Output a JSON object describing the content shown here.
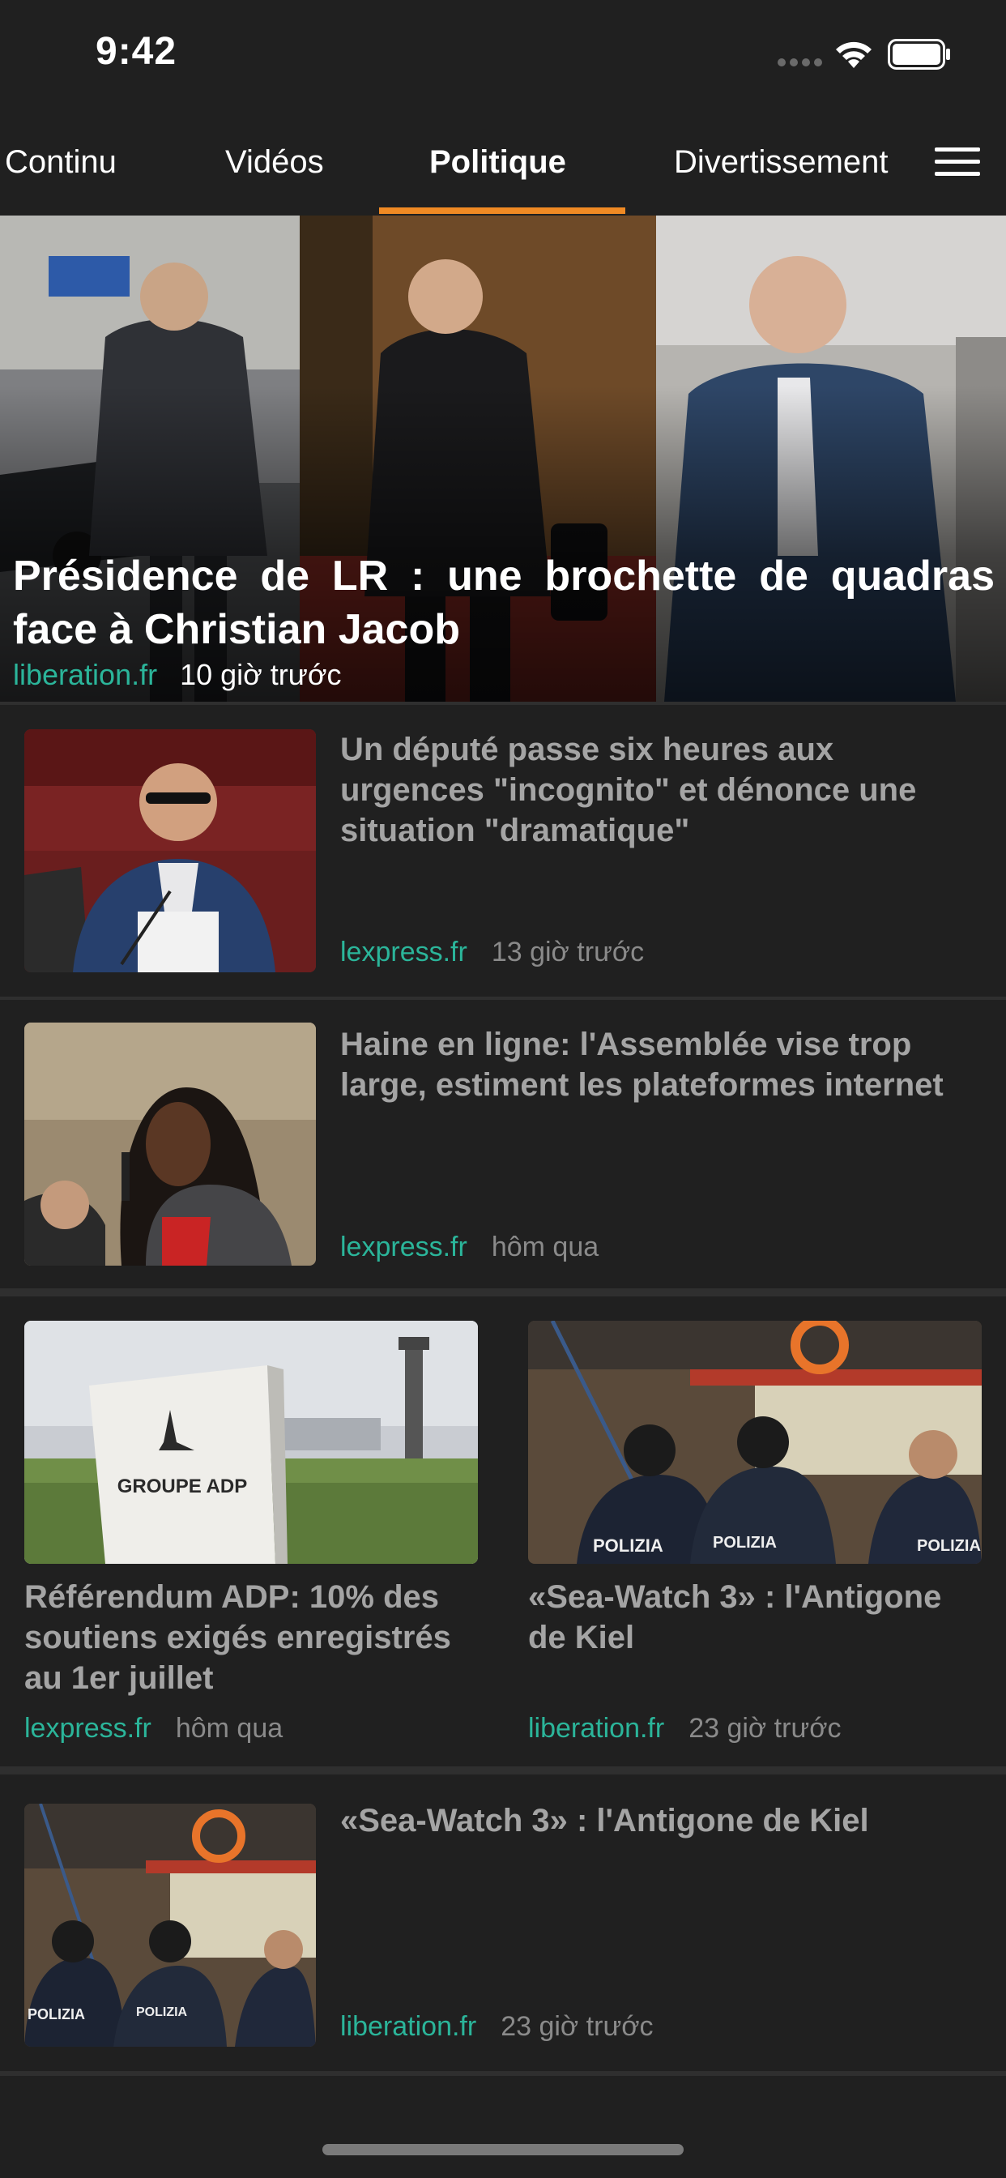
{
  "status_bar": {
    "time": "9:42",
    "icons": [
      "signal-dots-icon",
      "wifi-icon",
      "battery-icon"
    ]
  },
  "tabs": [
    {
      "label": "Continu",
      "active": false
    },
    {
      "label": "Vidéos",
      "active": false
    },
    {
      "label": "Politique",
      "active": true
    },
    {
      "label": "Divertissement",
      "active": false
    }
  ],
  "menu_icon": "hamburger-menu-icon",
  "colors": {
    "background": "#202020",
    "accent_tab": "#f08a24",
    "source": "#2bb59a",
    "title_gray": "#a4a4a4",
    "time_gray": "#8a8a8a"
  },
  "hero": {
    "title": "Présidence de LR : une brochette de quadras face à Christian Jacob",
    "source": "liberation.fr",
    "time": "10 giờ trước"
  },
  "articles": [
    {
      "title": "Un député passe six heures aux urgences \"incognito\" et dénonce une situation \"dramatique\"",
      "source": "lexpress.fr",
      "time": "13 giờ trước"
    },
    {
      "title": "Haine en ligne: l'Assemblée vise trop large, estiment les plateformes internet",
      "source": "lexpress.fr",
      "time": "hôm qua"
    }
  ],
  "grid": [
    {
      "title": "Référendum ADP: 10% des soutiens exigés enregistrés au 1er juillet",
      "source": "lexpress.fr",
      "time": "hôm qua",
      "sign_text": "GROUPE ADP"
    },
    {
      "title": "«Sea-Watch 3» : l'Antigone de Kiel",
      "source": "liberation.fr",
      "time": "23 giờ trước",
      "vest_text": "POLIZIA"
    }
  ],
  "last_article": {
    "title": "«Sea-Watch 3» : l'Antigone de Kiel",
    "source": "liberation.fr",
    "time": "23 giờ trước",
    "vest_text": "POLIZIA"
  }
}
